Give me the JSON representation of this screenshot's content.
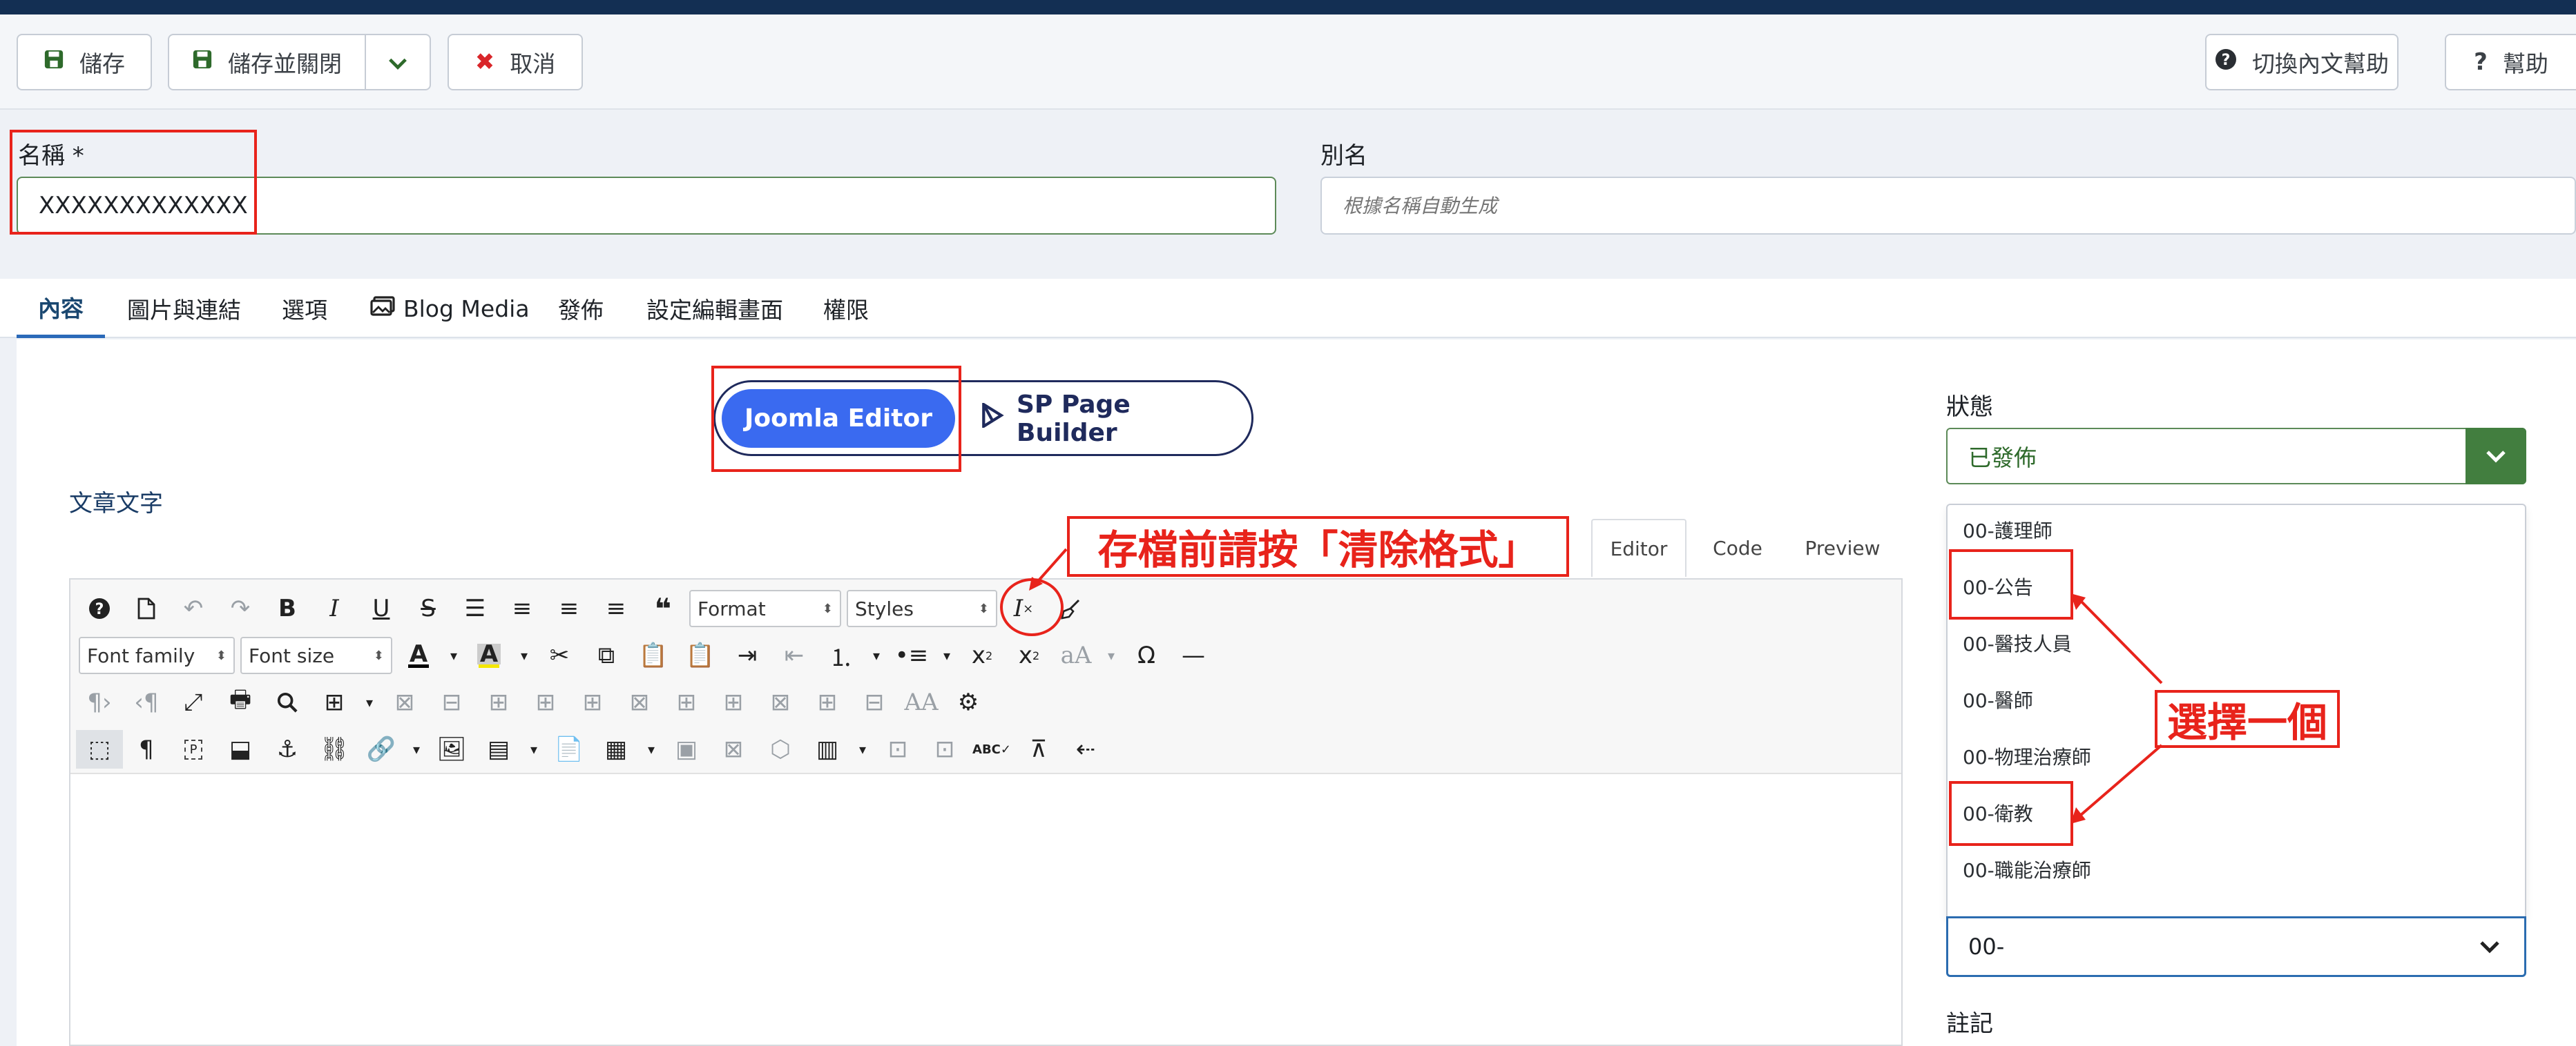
{
  "toolbar": {
    "save_label": "儲存",
    "save_close_label": "儲存並關閉",
    "cancel_label": "取消",
    "toggle_help_label": "切換內文幫助",
    "help_label": "幫助"
  },
  "form": {
    "title_label": "名稱 *",
    "title_value": "XXXXXXXXXXXXX",
    "alias_label": "別名",
    "alias_placeholder": "根據名稱自動生成"
  },
  "tabs": [
    "內容",
    "圖片與連結",
    "選項",
    "Blog Media",
    "發佈",
    "設定編輯畫面",
    "權限"
  ],
  "builder_switch": {
    "joomla": "Joomla Editor",
    "sppb": "SP Page Builder"
  },
  "editor": {
    "field_label": "文章文字",
    "view_tabs": [
      "Editor",
      "Code",
      "Preview"
    ],
    "format_select": "Format",
    "styles_select": "Styles",
    "font_family_select": "Font family",
    "font_size_select": "Font size"
  },
  "annotations": {
    "clear_format_note": "存檔前請按「清除格式」",
    "choose_one_note": "選擇一個"
  },
  "sidebar": {
    "status_label": "狀態",
    "status_value": "已發佈",
    "category_options": [
      "00-護理師",
      "00-公告",
      "00-醫技人員",
      "00-醫師",
      "00-物理治療師",
      "00-衛教",
      "00-職能治療師"
    ],
    "category_search_value": "00-",
    "note_label": "註記"
  },
  "colors": {
    "annotation_red": "#e8231b",
    "joomla_blue": "#3a6af0",
    "status_green": "#427e3f",
    "topbar_navy": "#132f53"
  }
}
